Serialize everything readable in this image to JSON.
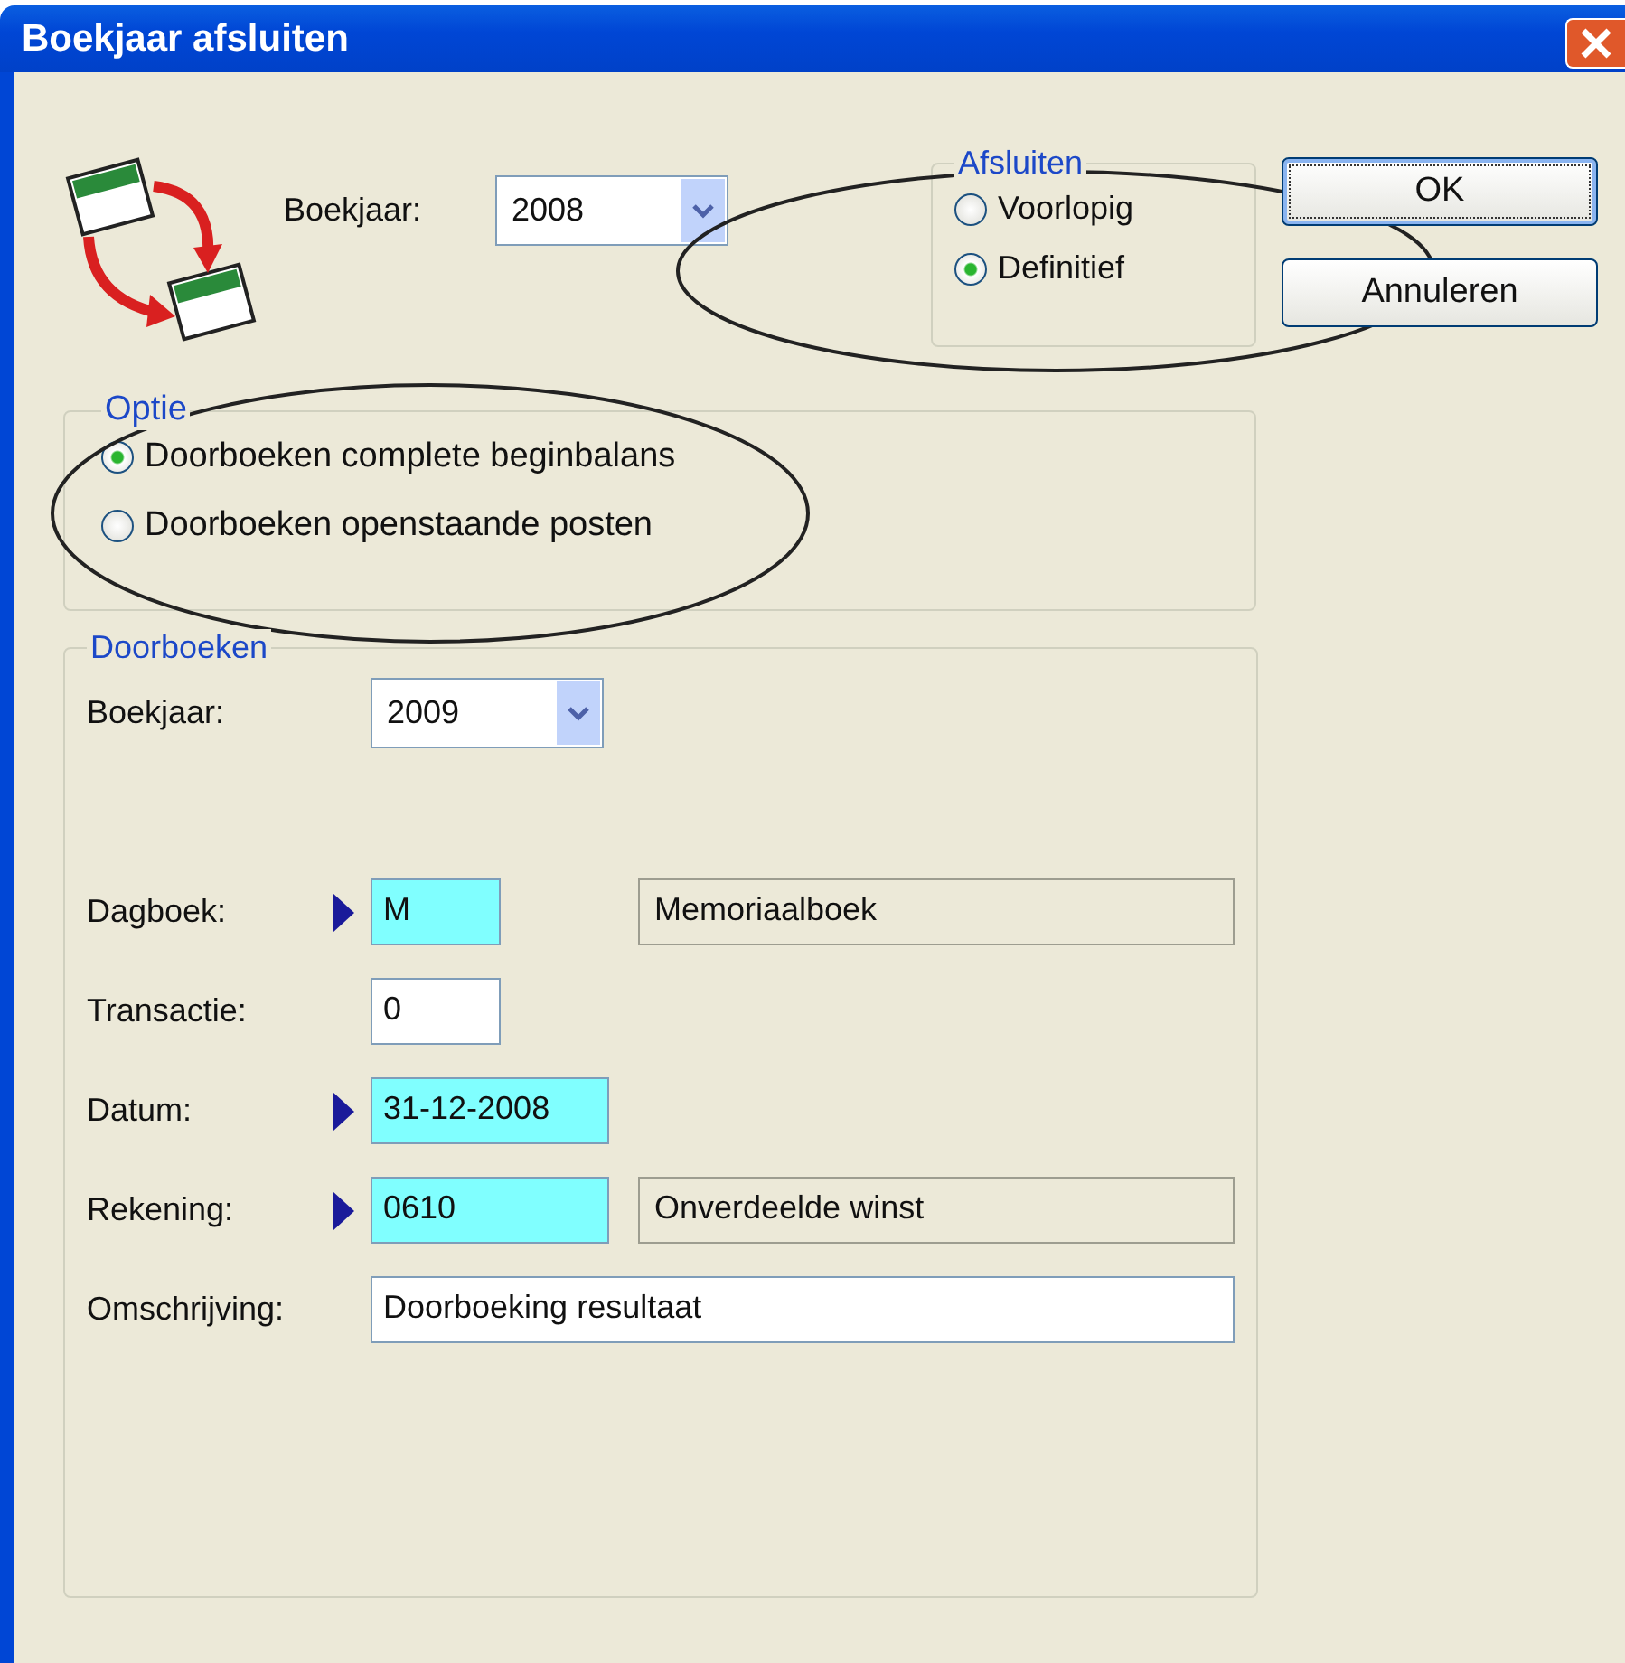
{
  "window": {
    "title": "Boekjaar afsluiten"
  },
  "boekjaar": {
    "label": "Boekjaar:",
    "value": "2008"
  },
  "afsluiten": {
    "legend": "Afsluiten",
    "options": [
      {
        "label": "Voorlopig",
        "selected": false
      },
      {
        "label": "Definitief",
        "selected": true
      }
    ]
  },
  "buttons": [
    {
      "label": "OK",
      "default": true
    },
    {
      "label": "Annuleren",
      "default": false
    }
  ],
  "optie": {
    "legend": "Optie",
    "options": [
      {
        "label": "Doorboeken complete beginbalans",
        "selected": true
      },
      {
        "label": "Doorboeken openstaande posten",
        "selected": false
      }
    ]
  },
  "doorboeken": {
    "legend": "Doorboeken",
    "boekjaar": {
      "label": "Boekjaar:",
      "value": "2009"
    },
    "fields": [
      {
        "label": "Dagboek:",
        "kind": "lookup",
        "value": "M",
        "description": "Memoriaalboek"
      },
      {
        "label": "Transactie:",
        "kind": "plain",
        "value": "0"
      },
      {
        "label": "Datum:",
        "kind": "lookup",
        "value": "31-12-2008"
      },
      {
        "label": "Rekening:",
        "kind": "lookup",
        "value": "0610",
        "description": "Onverdeelde winst"
      },
      {
        "label": "Omschrijving:",
        "kind": "plain",
        "value": "Doorboeking resultaat"
      }
    ]
  }
}
